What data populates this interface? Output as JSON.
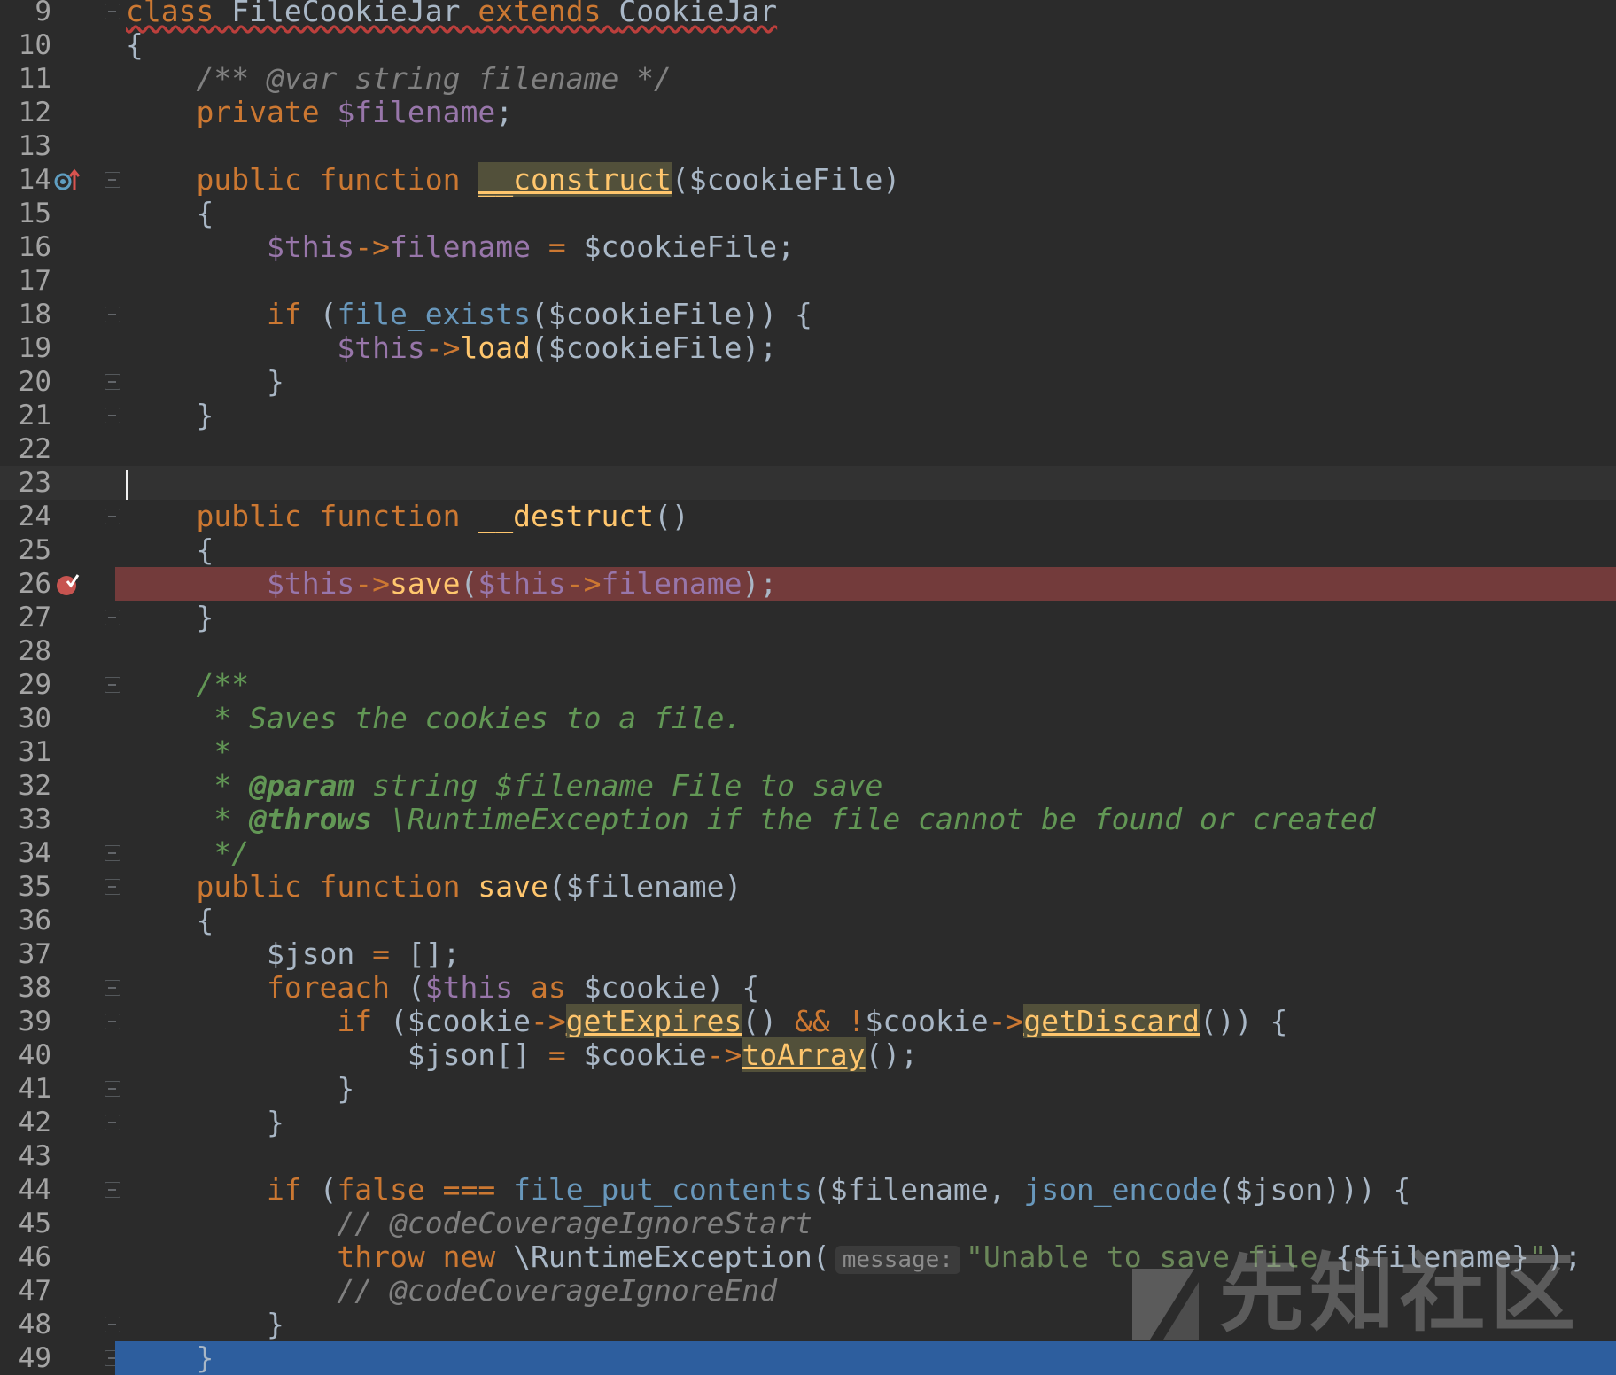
{
  "editor": {
    "language": "PHP",
    "watermark_text": "先知社区",
    "colors": {
      "background": "#2b2b2b",
      "keyword": "#cc7832",
      "function": "#ffc66d",
      "variable": "#9876aa",
      "string": "#6a8759",
      "comment": "#808080",
      "doc_comment": "#629755",
      "breakpoint_line": "#733b3b",
      "execution_line": "#2d5e9e"
    },
    "lines": [
      {
        "n": "9",
        "tokens": [
          [
            "kw err",
            "class "
          ],
          [
            "cls err",
            "FileCookieJar "
          ],
          [
            "kw err",
            "extends "
          ],
          [
            "cls err",
            "CookieJar"
          ]
        ]
      },
      {
        "n": "10",
        "tokens": [
          [
            "plain",
            "{"
          ]
        ]
      },
      {
        "n": "11",
        "tokens": [
          [
            "plain",
            "    "
          ],
          [
            "cm",
            "/** @var string filename */"
          ]
        ]
      },
      {
        "n": "12",
        "tokens": [
          [
            "plain",
            "    "
          ],
          [
            "kw",
            "private "
          ],
          [
            "var",
            "$filename"
          ],
          [
            "plain",
            ";"
          ]
        ]
      },
      {
        "n": "13",
        "tokens": []
      },
      {
        "n": "14",
        "tokens": [
          [
            "plain",
            "    "
          ],
          [
            "kw",
            "public function "
          ],
          [
            "fn hl",
            "__construct"
          ],
          [
            "plain",
            "("
          ],
          [
            "plain",
            "$cookieFile"
          ],
          [
            "plain",
            ")"
          ]
        ]
      },
      {
        "n": "15",
        "tokens": [
          [
            "plain",
            "    {"
          ]
        ]
      },
      {
        "n": "16",
        "tokens": [
          [
            "plain",
            "        "
          ],
          [
            "var",
            "$this"
          ],
          [
            "op",
            "->"
          ],
          [
            "prop",
            "filename"
          ],
          [
            "op",
            " = "
          ],
          [
            "plain",
            "$cookieFile;"
          ]
        ]
      },
      {
        "n": "17",
        "tokens": []
      },
      {
        "n": "18",
        "tokens": [
          [
            "plain",
            "        "
          ],
          [
            "kw",
            "if "
          ],
          [
            "plain",
            "("
          ],
          [
            "nat",
            "file_exists"
          ],
          [
            "plain",
            "($cookieFile)) {"
          ]
        ]
      },
      {
        "n": "19",
        "tokens": [
          [
            "plain",
            "            "
          ],
          [
            "var",
            "$this"
          ],
          [
            "op",
            "->"
          ],
          [
            "fn",
            "load"
          ],
          [
            "plain",
            "($cookieFile);"
          ]
        ]
      },
      {
        "n": "20",
        "tokens": [
          [
            "plain",
            "        }"
          ]
        ]
      },
      {
        "n": "21",
        "tokens": [
          [
            "plain",
            "    }"
          ]
        ]
      },
      {
        "n": "22",
        "tokens": []
      },
      {
        "n": "23",
        "tokens": []
      },
      {
        "n": "24",
        "tokens": [
          [
            "plain",
            "    "
          ],
          [
            "kw",
            "public function "
          ],
          [
            "fn",
            "__destruct"
          ],
          [
            "plain",
            "()"
          ]
        ]
      },
      {
        "n": "25",
        "tokens": [
          [
            "plain",
            "    {"
          ]
        ]
      },
      {
        "n": "26",
        "tokens": [
          [
            "plain",
            "        "
          ],
          [
            "var",
            "$this"
          ],
          [
            "op",
            "->"
          ],
          [
            "fn",
            "save"
          ],
          [
            "plain",
            "("
          ],
          [
            "var",
            "$this"
          ],
          [
            "op",
            "->"
          ],
          [
            "prop",
            "filename"
          ],
          [
            "plain",
            ");"
          ]
        ]
      },
      {
        "n": "27",
        "tokens": [
          [
            "plain",
            "    }"
          ]
        ]
      },
      {
        "n": "28",
        "tokens": []
      },
      {
        "n": "29",
        "tokens": [
          [
            "plain",
            "    "
          ],
          [
            "doc",
            "/**"
          ]
        ]
      },
      {
        "n": "30",
        "tokens": [
          [
            "plain",
            "     "
          ],
          [
            "doc",
            "* Saves the cookies to a file."
          ]
        ]
      },
      {
        "n": "31",
        "tokens": [
          [
            "plain",
            "     "
          ],
          [
            "doc",
            "*"
          ]
        ]
      },
      {
        "n": "32",
        "tokens": [
          [
            "plain",
            "     "
          ],
          [
            "doc",
            "* "
          ],
          [
            "doctag",
            "@param "
          ],
          [
            "doc",
            "string $filename File to save"
          ]
        ]
      },
      {
        "n": "33",
        "tokens": [
          [
            "plain",
            "     "
          ],
          [
            "doc",
            "* "
          ],
          [
            "doctag",
            "@throws "
          ],
          [
            "doc",
            "\\RuntimeException if the file cannot be found or created"
          ]
        ]
      },
      {
        "n": "34",
        "tokens": [
          [
            "plain",
            "     "
          ],
          [
            "doc",
            "*/"
          ]
        ]
      },
      {
        "n": "35",
        "tokens": [
          [
            "plain",
            "    "
          ],
          [
            "kw",
            "public function "
          ],
          [
            "fn",
            "save"
          ],
          [
            "plain",
            "($filename)"
          ]
        ]
      },
      {
        "n": "36",
        "tokens": [
          [
            "plain",
            "    {"
          ]
        ]
      },
      {
        "n": "37",
        "tokens": [
          [
            "plain",
            "        "
          ],
          [
            "plain",
            "$json "
          ],
          [
            "op",
            "= "
          ],
          [
            "plain",
            "[];"
          ]
        ]
      },
      {
        "n": "38",
        "tokens": [
          [
            "plain",
            "        "
          ],
          [
            "kw",
            "foreach "
          ],
          [
            "plain",
            "("
          ],
          [
            "var",
            "$this "
          ],
          [
            "kw",
            "as "
          ],
          [
            "plain",
            "$cookie) {"
          ]
        ]
      },
      {
        "n": "39",
        "tokens": [
          [
            "plain",
            "            "
          ],
          [
            "kw",
            "if "
          ],
          [
            "plain",
            "($cookie"
          ],
          [
            "op",
            "->"
          ],
          [
            "fn hl",
            "getExpires"
          ],
          [
            "plain",
            "() "
          ],
          [
            "op",
            "&& !"
          ],
          [
            "plain",
            "$cookie"
          ],
          [
            "op",
            "->"
          ],
          [
            "fn hl",
            "getDiscard"
          ],
          [
            "plain",
            "()) {"
          ]
        ]
      },
      {
        "n": "40",
        "tokens": [
          [
            "plain",
            "                "
          ],
          [
            "plain",
            "$json[] "
          ],
          [
            "op",
            "= "
          ],
          [
            "plain",
            "$cookie"
          ],
          [
            "op",
            "->"
          ],
          [
            "fn hl",
            "toArray"
          ],
          [
            "plain",
            "();"
          ]
        ]
      },
      {
        "n": "41",
        "tokens": [
          [
            "plain",
            "            }"
          ]
        ]
      },
      {
        "n": "42",
        "tokens": [
          [
            "plain",
            "        }"
          ]
        ]
      },
      {
        "n": "43",
        "tokens": []
      },
      {
        "n": "44",
        "tokens": [
          [
            "plain",
            "        "
          ],
          [
            "kw",
            "if "
          ],
          [
            "plain",
            "("
          ],
          [
            "kw",
            "false "
          ],
          [
            "op",
            "=== "
          ],
          [
            "nat",
            "file_put_contents"
          ],
          [
            "plain",
            "($filename, "
          ],
          [
            "nat",
            "json_encode"
          ],
          [
            "plain",
            "($json))) {"
          ]
        ]
      },
      {
        "n": "45",
        "tokens": [
          [
            "plain",
            "            "
          ],
          [
            "cm",
            "// @codeCoverageIgnoreStart"
          ]
        ]
      },
      {
        "n": "46",
        "tokens": [
          [
            "plain",
            "            "
          ],
          [
            "kw",
            "throw new "
          ],
          [
            "plain",
            "\\RuntimeException("
          ],
          [
            "hint",
            "message:"
          ],
          [
            "str",
            "\"Unable to save file "
          ],
          [
            "plain",
            "{$filename}"
          ],
          [
            "str",
            "\""
          ],
          [
            "plain",
            ");"
          ]
        ]
      },
      {
        "n": "47",
        "tokens": [
          [
            "plain",
            "            "
          ],
          [
            "cm",
            "// @codeCoverageIgnoreEnd"
          ]
        ]
      },
      {
        "n": "48",
        "tokens": [
          [
            "plain",
            "        }"
          ]
        ]
      },
      {
        "n": "49",
        "tokens": [
          [
            "plain",
            "    }"
          ]
        ]
      }
    ]
  }
}
